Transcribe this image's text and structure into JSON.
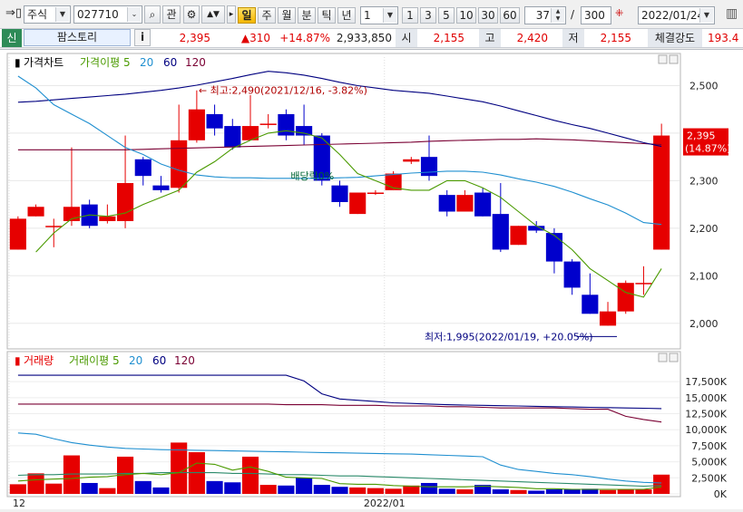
{
  "toolbar": {
    "market_select": "주식",
    "code_input": "027710",
    "btn_gwan": "관",
    "btn_il": "일",
    "btn_ju": "주",
    "btn_wol": "월",
    "btn_bun": "분",
    "btn_tik": "틱",
    "btn_nyeon": "년",
    "period_select": "1",
    "range_buttons": [
      "1",
      "3",
      "5",
      "10",
      "30",
      "60"
    ],
    "view_count": "37",
    "slash": "/",
    "total_count": "300",
    "date_select": "2022/01/24"
  },
  "quote": {
    "badge": "신",
    "name": "팜스토리",
    "info_btn": "i",
    "price": "2,395",
    "change": "▲310",
    "change_pct": "+14.87%",
    "volume": "2,933,850",
    "open_label": "시",
    "open": "2,155",
    "high_label": "고",
    "high": "2,420",
    "low_label": "저",
    "low": "2,155",
    "strength_label": "체결강도",
    "strength": "193.4"
  },
  "colors": {
    "up": "#e60000",
    "down": "#0000cc",
    "ma5": "#4a9a00",
    "ma20": "#1f8fd0",
    "ma60": "#000080",
    "ma120": "#7a0033"
  },
  "chart_data": [
    {
      "type": "candlestick",
      "legend": [
        {
          "name": "가격차트",
          "color": "#000000"
        },
        {
          "name": "가격이평 5",
          "color": "#4a9a00"
        },
        {
          "name": "20",
          "color": "#1f8fd0"
        },
        {
          "name": "60",
          "color": "#000080"
        },
        {
          "name": "120",
          "color": "#7a0033"
        }
      ],
      "ylim": [
        1950,
        2560
      ],
      "yticks": [
        2000,
        2100,
        2200,
        2300,
        2400,
        2500
      ],
      "ytick_labels": [
        "2,000",
        "2,100",
        "2,200",
        "2,300",
        "2,400",
        "2,500"
      ],
      "xtick_labels": [
        {
          "label": "12",
          "index": 0
        },
        {
          "label": "2022/01",
          "index": 21
        }
      ],
      "candles": [
        {
          "o": 2155,
          "h": 2225,
          "l": 2155,
          "c": 2220
        },
        {
          "o": 2225,
          "h": 2250,
          "l": 2225,
          "c": 2245
        },
        {
          "o": 2205,
          "h": 2220,
          "l": 2160,
          "c": 2205
        },
        {
          "o": 2215,
          "h": 2370,
          "l": 2205,
          "c": 2245
        },
        {
          "o": 2250,
          "h": 2260,
          "l": 2200,
          "c": 2205
        },
        {
          "o": 2215,
          "h": 2250,
          "l": 2210,
          "c": 2225
        },
        {
          "o": 2215,
          "h": 2395,
          "l": 2200,
          "c": 2295
        },
        {
          "o": 2345,
          "h": 2350,
          "l": 2290,
          "c": 2310
        },
        {
          "o": 2290,
          "h": 2310,
          "l": 2275,
          "c": 2280
        },
        {
          "o": 2285,
          "h": 2460,
          "l": 2275,
          "c": 2385
        },
        {
          "o": 2385,
          "h": 2490,
          "l": 2380,
          "c": 2450
        },
        {
          "o": 2440,
          "h": 2460,
          "l": 2395,
          "c": 2410
        },
        {
          "o": 2415,
          "h": 2430,
          "l": 2365,
          "c": 2370
        },
        {
          "o": 2385,
          "h": 2480,
          "l": 2385,
          "c": 2415
        },
        {
          "o": 2420,
          "h": 2440,
          "l": 2410,
          "c": 2420
        },
        {
          "o": 2440,
          "h": 2450,
          "l": 2385,
          "c": 2395
        },
        {
          "o": 2415,
          "h": 2460,
          "l": 2375,
          "c": 2395
        },
        {
          "o": 2395,
          "h": 2400,
          "l": 2290,
          "c": 2300
        },
        {
          "o": 2290,
          "h": 2300,
          "l": 2245,
          "c": 2255
        },
        {
          "o": 2230,
          "h": 2275,
          "l": 2230,
          "c": 2275
        },
        {
          "o": 2275,
          "h": 2280,
          "l": 2270,
          "c": 2275
        },
        {
          "o": 2280,
          "h": 2320,
          "l": 2280,
          "c": 2315
        },
        {
          "o": 2340,
          "h": 2350,
          "l": 2335,
          "c": 2345
        },
        {
          "o": 2350,
          "h": 2395,
          "l": 2300,
          "c": 2310
        },
        {
          "o": 2270,
          "h": 2280,
          "l": 2225,
          "c": 2235
        },
        {
          "o": 2235,
          "h": 2280,
          "l": 2235,
          "c": 2270
        },
        {
          "o": 2275,
          "h": 2285,
          "l": 2225,
          "c": 2225
        },
        {
          "o": 2230,
          "h": 2295,
          "l": 2150,
          "c": 2155
        },
        {
          "o": 2165,
          "h": 2205,
          "l": 2165,
          "c": 2205
        },
        {
          "o": 2205,
          "h": 2215,
          "l": 2190,
          "c": 2195
        },
        {
          "o": 2190,
          "h": 2200,
          "l": 2105,
          "c": 2130
        },
        {
          "o": 2130,
          "h": 2135,
          "l": 2060,
          "c": 2075
        },
        {
          "o": 2060,
          "h": 2105,
          "l": 2020,
          "c": 2020
        },
        {
          "o": 1995,
          "h": 2045,
          "l": 1995,
          "c": 2025
        },
        {
          "o": 2025,
          "h": 2090,
          "l": 2020,
          "c": 2085
        },
        {
          "o": 2085,
          "h": 2120,
          "l": 2060,
          "c": 2085
        },
        {
          "o": 2155,
          "h": 2420,
          "l": 2155,
          "c": 2395
        }
      ],
      "ma5": [
        null,
        2150,
        2190,
        2220,
        2228,
        2225,
        2232,
        2250,
        2265,
        2280,
        2318,
        2340,
        2368,
        2385,
        2400,
        2405,
        2400,
        2390,
        2355,
        2315,
        2300,
        2285,
        2280,
        2280,
        2300,
        2300,
        2285,
        2265,
        2235,
        2205,
        2185,
        2155,
        2115,
        2090,
        2065,
        2055,
        2115
      ],
      "ma20": [
        2520,
        2495,
        2460,
        2440,
        2420,
        2395,
        2370,
        2355,
        2335,
        2322,
        2312,
        2308,
        2306,
        2306,
        2305,
        2305,
        2305,
        2305,
        2306,
        2307,
        2310,
        2313,
        2316,
        2318,
        2320,
        2320,
        2318,
        2312,
        2304,
        2297,
        2288,
        2276,
        2262,
        2249,
        2232,
        2212,
        2208
      ],
      "ma60": [
        2465,
        2467,
        2470,
        2473,
        2476,
        2479,
        2482,
        2486,
        2490,
        2495,
        2501,
        2508,
        2515,
        2523,
        2530,
        2527,
        2522,
        2515,
        2507,
        2500,
        2495,
        2490,
        2487,
        2484,
        2478,
        2472,
        2466,
        2457,
        2447,
        2437,
        2427,
        2418,
        2410,
        2400,
        2390,
        2380,
        2372
      ],
      "ma120": [
        2365,
        2365,
        2365,
        2365,
        2365,
        2365,
        2365,
        2366,
        2367,
        2368,
        2369,
        2370,
        2371,
        2372,
        2373,
        2374,
        2375,
        2376,
        2377,
        2378,
        2379,
        2380,
        2381,
        2383,
        2384,
        2385,
        2386,
        2387,
        2387,
        2388,
        2387,
        2386,
        2384,
        2382,
        2380,
        2378,
        2376
      ],
      "annotations": {
        "high_label": "← 최고:2,490(2021/12/16, -3.82%)",
        "low_label": "최저:1,995(2022/01/19, +20.05%)",
        "dividend_label": "배당락0%",
        "last_price": "2,395",
        "last_pct": "(14.87%)"
      }
    },
    {
      "type": "bar",
      "legend": [
        {
          "name": "거래량",
          "color": "#e60000"
        },
        {
          "name": "거래이평 5",
          "color": "#4a9a00"
        },
        {
          "name": "20",
          "color": "#1f8fd0"
        },
        {
          "name": "60",
          "color": "#000080"
        },
        {
          "name": "120",
          "color": "#7a0033"
        }
      ],
      "ylim": [
        0,
        19500
      ],
      "yticks": [
        0,
        2500,
        5000,
        7500,
        10000,
        12500,
        15000,
        17500
      ],
      "ytick_labels": [
        "0K",
        "2,500K",
        "5,000K",
        "7,500K",
        "10,000K",
        "12,500K",
        "15,000K",
        "17,500K"
      ],
      "volume": [
        1500,
        3200,
        1600,
        6000,
        1700,
        900,
        5800,
        2000,
        1000,
        8000,
        6500,
        2000,
        1800,
        5800,
        1400,
        1300,
        2500,
        1400,
        1100,
        1000,
        900,
        800,
        1300,
        1700,
        800,
        700,
        1400,
        700,
        600,
        500,
        700,
        700,
        800,
        600,
        700,
        700,
        3000
      ],
      "vma5": [
        2000,
        2200,
        2300,
        2400,
        2600,
        2700,
        3000,
        3200,
        3000,
        3300,
        4800,
        4600,
        3700,
        4200,
        3500,
        2600,
        2500,
        2400,
        1600,
        1500,
        1500,
        1300,
        1200,
        1100,
        1100,
        1100,
        1200,
        1100,
        1000,
        800,
        800,
        700,
        700,
        700,
        700,
        700,
        1100
      ],
      "vma20": [
        2900,
        3000,
        3000,
        3100,
        3100,
        3100,
        3200,
        3200,
        3300,
        3300,
        3300,
        3300,
        3200,
        3200,
        3100,
        3000,
        3000,
        2900,
        2800,
        2800,
        2700,
        2600,
        2500,
        2400,
        2300,
        2200,
        2100,
        2000,
        1900,
        1800,
        1700,
        1600,
        1500,
        1400,
        1300,
        1200,
        1300
      ],
      "vma60": [
        9500,
        9300,
        8600,
        8000,
        7600,
        7300,
        7100,
        7000,
        6900,
        6850,
        6800,
        6750,
        6700,
        6650,
        6600,
        6550,
        6500,
        6450,
        6400,
        6350,
        6300,
        6250,
        6200,
        6100,
        6000,
        5900,
        5800,
        4500,
        3800,
        3500,
        3200,
        3000,
        2700,
        2300,
        2000,
        1800,
        1700
      ],
      "vma120": [
        18500,
        18500,
        18500,
        18500,
        18500,
        18500,
        18500,
        18500,
        18500,
        18500,
        18500,
        18500,
        18500,
        18500,
        18500,
        18500,
        17600,
        15600,
        14800,
        14600,
        14400,
        14200,
        14100,
        14000,
        13900,
        13850,
        13800,
        13750,
        13700,
        13650,
        13600,
        13550,
        13500,
        13450,
        13400,
        13350,
        13300
      ],
      "ma_tail": [
        14000,
        14000,
        14000,
        14000,
        14000,
        14000,
        14000,
        14000,
        14000,
        14000,
        14000,
        14000,
        14000,
        14000,
        14000,
        13900,
        13900,
        13900,
        13800,
        13800,
        13800,
        13700,
        13700,
        13700,
        13600,
        13600,
        13500,
        13400,
        13400,
        13400,
        13400,
        13300,
        13200,
        13200,
        12100,
        11600,
        11200
      ]
    }
  ]
}
